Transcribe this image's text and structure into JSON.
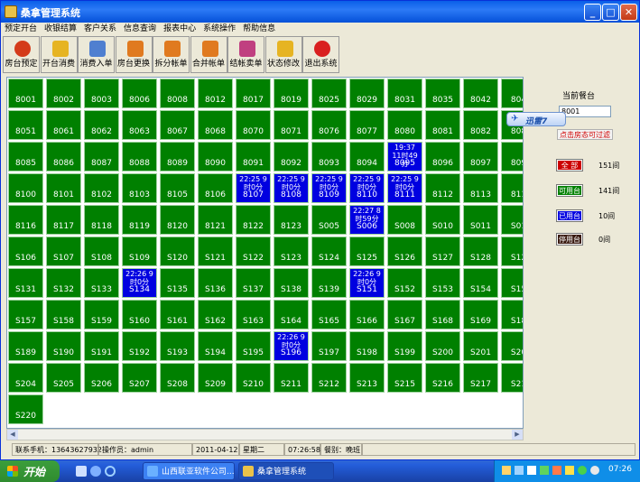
{
  "window": {
    "title": "桑拿管理系统",
    "min": "_",
    "max": "□",
    "close": "✕"
  },
  "menu": [
    "预定开台",
    "收银结算",
    "客户关系",
    "信息查询",
    "报表中心",
    "系统操作",
    "帮助信息"
  ],
  "toolbar": [
    {
      "label": "房台预定",
      "icon": "alarm-clock-icon",
      "color": "#d43b1a"
    },
    {
      "label": "开台消费",
      "icon": "lock-icon",
      "color": "#e6b422"
    },
    {
      "label": "消费入单",
      "icon": "printer-icon",
      "color": "#4f7fd0"
    },
    {
      "label": "房台更换",
      "icon": "swap-icon",
      "color": "#e07a1f"
    },
    {
      "label": "拆分帐单",
      "icon": "split-icon",
      "color": "#e07a1f"
    },
    {
      "label": "合并帐单",
      "icon": "merge-icon",
      "color": "#e07a1f"
    },
    {
      "label": "结帐卖单",
      "icon": "cash-register-icon",
      "color": "#c04080"
    },
    {
      "label": "状态修改",
      "icon": "lock-icon",
      "color": "#e6b422"
    },
    {
      "label": "退出系统",
      "icon": "exit-icon",
      "color": "#d92020"
    }
  ],
  "grid": {
    "rows": [
      [
        {
          "n": "8001"
        },
        {
          "n": "8002"
        },
        {
          "n": "8003"
        },
        {
          "n": "8006"
        },
        {
          "n": "8008"
        },
        {
          "n": "8012"
        },
        {
          "n": "8017"
        },
        {
          "n": "8019"
        },
        {
          "n": "8025"
        },
        {
          "n": "8029"
        },
        {
          "n": "8031"
        },
        {
          "n": "8035"
        },
        {
          "n": "8042"
        },
        {
          "n": "804"
        }
      ],
      [
        {
          "n": "8051"
        },
        {
          "n": "8061"
        },
        {
          "n": "8062"
        },
        {
          "n": "8063"
        },
        {
          "n": "8067"
        },
        {
          "n": "8068"
        },
        {
          "n": "8070"
        },
        {
          "n": "8071"
        },
        {
          "n": "8076"
        },
        {
          "n": "8077"
        },
        {
          "n": "8080"
        },
        {
          "n": "8081"
        },
        {
          "n": "8082"
        },
        {
          "n": "808"
        }
      ],
      [
        {
          "n": "8085"
        },
        {
          "n": "8086"
        },
        {
          "n": "8087"
        },
        {
          "n": "8088"
        },
        {
          "n": "8089"
        },
        {
          "n": "8090"
        },
        {
          "n": "8091"
        },
        {
          "n": "8092"
        },
        {
          "n": "8093"
        },
        {
          "n": "8094"
        },
        {
          "n": "8095",
          "t": "19:37 11时49分",
          "u": true
        },
        {
          "n": "8096"
        },
        {
          "n": "8097"
        },
        {
          "n": "809"
        }
      ],
      [
        {
          "n": "8100"
        },
        {
          "n": "8101"
        },
        {
          "n": "8102"
        },
        {
          "n": "8103"
        },
        {
          "n": "8105"
        },
        {
          "n": "8106"
        },
        {
          "n": "8107",
          "t": "22:25 9时0分",
          "u": true
        },
        {
          "n": "8108",
          "t": "22:25 9时0分",
          "u": true
        },
        {
          "n": "8109",
          "t": "22:25 9时0分",
          "u": true
        },
        {
          "n": "8110",
          "t": "22:25 9时0分",
          "u": true
        },
        {
          "n": "8111",
          "t": "22:25 9时0分",
          "u": true
        },
        {
          "n": "8112"
        },
        {
          "n": "8113"
        },
        {
          "n": "811"
        }
      ],
      [
        {
          "n": "8116"
        },
        {
          "n": "8117"
        },
        {
          "n": "8118"
        },
        {
          "n": "8119"
        },
        {
          "n": "8120"
        },
        {
          "n": "8121"
        },
        {
          "n": "8122"
        },
        {
          "n": "8123"
        },
        {
          "n": "S005"
        },
        {
          "n": "S006",
          "t": "22:27 8时59分",
          "u": true
        },
        {
          "n": "S008"
        },
        {
          "n": "S010"
        },
        {
          "n": "S011"
        },
        {
          "n": "S01"
        }
      ],
      [
        {
          "n": "S106"
        },
        {
          "n": "S107"
        },
        {
          "n": "S108"
        },
        {
          "n": "S109"
        },
        {
          "n": "S120"
        },
        {
          "n": "S121"
        },
        {
          "n": "S122"
        },
        {
          "n": "S123"
        },
        {
          "n": "S124"
        },
        {
          "n": "S125"
        },
        {
          "n": "S126"
        },
        {
          "n": "S127"
        },
        {
          "n": "S128"
        },
        {
          "n": "S12"
        }
      ],
      [
        {
          "n": "S131"
        },
        {
          "n": "S132"
        },
        {
          "n": "S133"
        },
        {
          "n": "S134",
          "t": "22:26 9时0分",
          "u": true
        },
        {
          "n": "S135"
        },
        {
          "n": "S136"
        },
        {
          "n": "S137"
        },
        {
          "n": "S138"
        },
        {
          "n": "S139"
        },
        {
          "n": "S151",
          "t": "22:26 9时0分",
          "u": true
        },
        {
          "n": "S152"
        },
        {
          "n": "S153"
        },
        {
          "n": "S154"
        },
        {
          "n": "S15"
        }
      ],
      [
        {
          "n": "S157"
        },
        {
          "n": "S158"
        },
        {
          "n": "S159"
        },
        {
          "n": "S160"
        },
        {
          "n": "S161"
        },
        {
          "n": "S162"
        },
        {
          "n": "S163"
        },
        {
          "n": "S164"
        },
        {
          "n": "S165"
        },
        {
          "n": "S166"
        },
        {
          "n": "S167"
        },
        {
          "n": "S168"
        },
        {
          "n": "S169"
        },
        {
          "n": "S18"
        }
      ],
      [
        {
          "n": "S189"
        },
        {
          "n": "S190"
        },
        {
          "n": "S191"
        },
        {
          "n": "S192"
        },
        {
          "n": "S193"
        },
        {
          "n": "S194"
        },
        {
          "n": "S195"
        },
        {
          "n": "S196",
          "t": "22:26 9时0分",
          "u": true
        },
        {
          "n": "S197"
        },
        {
          "n": "S198"
        },
        {
          "n": "S199"
        },
        {
          "n": "S200"
        },
        {
          "n": "S201"
        },
        {
          "n": "S20"
        }
      ],
      [
        {
          "n": "S204"
        },
        {
          "n": "S205"
        },
        {
          "n": "S206"
        },
        {
          "n": "S207"
        },
        {
          "n": "S208"
        },
        {
          "n": "S209"
        },
        {
          "n": "S210"
        },
        {
          "n": "S211"
        },
        {
          "n": "S212"
        },
        {
          "n": "S213"
        },
        {
          "n": "S215"
        },
        {
          "n": "S216"
        },
        {
          "n": "S217"
        },
        {
          "n": "S21"
        }
      ],
      [
        {
          "n": "S220"
        }
      ]
    ]
  },
  "side": {
    "current_label": "当前餐台",
    "current_value": "8001",
    "filter_button": "点击房态可过滤",
    "popup": "迅雷7",
    "legend": [
      {
        "label": "全 部",
        "count": "151间",
        "color": "#cc0000"
      },
      {
        "label": "可用台",
        "count": "141间",
        "color": "#008000"
      },
      {
        "label": "已用台",
        "count": "10间",
        "color": "#0000e0"
      },
      {
        "label": "停用台",
        "count": "0间",
        "color": "#3a1a10"
      }
    ]
  },
  "status": {
    "phone": "联系手机：13643627932",
    "operator": "操作员：admin",
    "date": "2011-04-12",
    "weekday": "星期二",
    "time": "07:26:58",
    "shift": "餐别：晚班"
  },
  "taskbar": {
    "start": "开始",
    "tasks": [
      "山西联亚软件公司...",
      "桑拿管理系统"
    ],
    "clock": "07:26"
  }
}
